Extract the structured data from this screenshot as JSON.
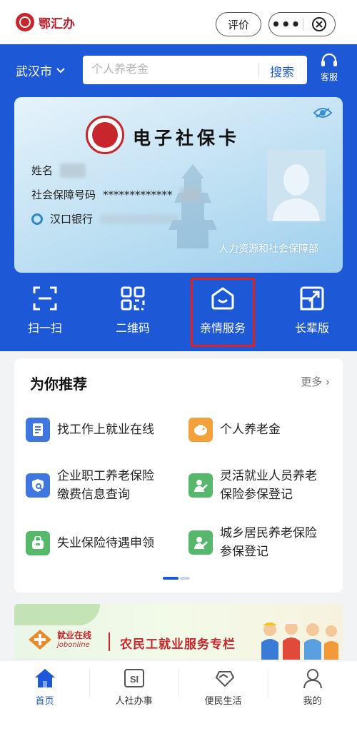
{
  "app": {
    "name": "鄂汇办"
  },
  "topbar": {
    "rate_label": "评价",
    "more_label": "•••"
  },
  "header": {
    "city": "武汉市",
    "search_placeholder": "个人养老金",
    "search_button": "搜索",
    "service_label": "客服"
  },
  "card": {
    "title": "电子社保卡",
    "name_label": "姓名",
    "ssn_label": "社会保障号码",
    "ssn_masked": "*************",
    "bank": "汉口银行",
    "department": "人力资源和社会保障部"
  },
  "quick_actions": [
    {
      "label": "扫一扫",
      "icon": "scan-icon"
    },
    {
      "label": "二维码",
      "icon": "qrcode-icon"
    },
    {
      "label": "亲情服务",
      "icon": "family-service-icon",
      "highlighted": true
    },
    {
      "label": "长辈版",
      "icon": "elder-mode-icon"
    }
  ],
  "recommend": {
    "title": "为你推荐",
    "more": "更多 ›",
    "items": [
      {
        "lines": [
          "找工作上就业在线"
        ],
        "icon": "document-icon",
        "color": "#3f76e0"
      },
      {
        "lines": [
          "个人养老金"
        ],
        "icon": "piggy-bank-icon",
        "color": "#f2a13b"
      },
      {
        "lines": [
          "企业职工养老保险",
          "缴费信息查询"
        ],
        "icon": "insurance-query-icon",
        "color": "#3f76e0"
      },
      {
        "lines": [
          "灵活就业人员养老",
          "保险参保登记"
        ],
        "icon": "person-register-icon",
        "color": "#56b86a"
      },
      {
        "lines": [
          "失业保险待遇申领"
        ],
        "icon": "bag-icon",
        "color": "#56b86a"
      },
      {
        "lines": [
          "城乡居民养老保险",
          "参保登记"
        ],
        "icon": "person-register-icon",
        "color": "#56b86a"
      }
    ]
  },
  "banner": {
    "logo_text": "就业在线",
    "logo_sub": "jobonline",
    "headline": "农民工就业服务专栏"
  },
  "nav": [
    {
      "label": "首页",
      "icon": "home-icon",
      "active": true
    },
    {
      "label": "人社办事",
      "icon": "si-icon"
    },
    {
      "label": "便民生活",
      "icon": "handshake-icon"
    },
    {
      "label": "我的",
      "icon": "user-icon"
    }
  ]
}
